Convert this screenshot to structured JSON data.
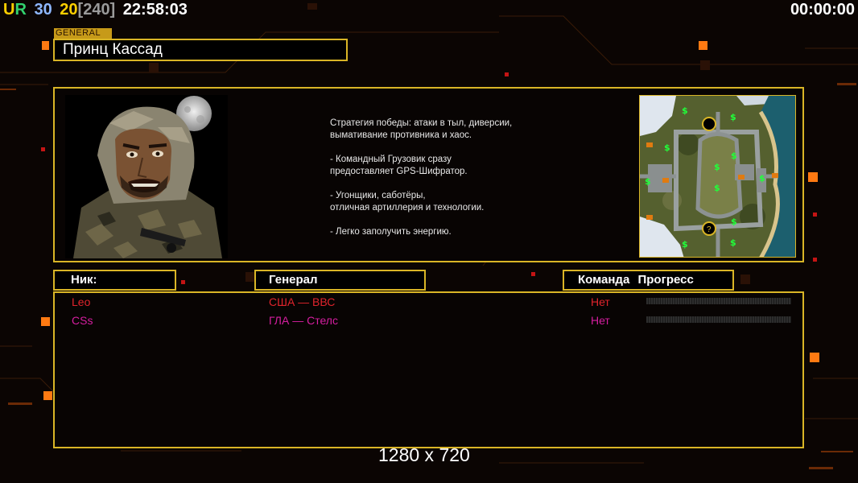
{
  "hud": {
    "ur": "UR",
    "n1": "30",
    "n2": "20",
    "bracket": "[240]",
    "time": "22:58:03",
    "timer": "00:00:00"
  },
  "general": {
    "tag": "GENERAL",
    "name": "Принц Кассад"
  },
  "description": [
    "Стратегия победы: атаки в тыл, диверсии,\n вымативание противника и хаос.",
    "- Командный Грузовик сразу\nпредоставляет GPS-Шифратор.",
    "- Угонщики, саботёры,\nотличная артиллерия и технологии.",
    "- Легко заполучить энергию."
  ],
  "table": {
    "headers": {
      "nick": "Ник:",
      "general": "Генерал",
      "team": "Команда",
      "progress": "Прогресс"
    },
    "rows": [
      {
        "nick": "Leo",
        "general": "США — ВВС",
        "team": "Нет",
        "color": "#e0242c",
        "progress": 0
      },
      {
        "nick": "CSs",
        "general": "ГЛА — Стелс",
        "team": "Нет",
        "color": "#d61ea0",
        "progress": 0
      }
    ]
  },
  "resolution": "1280 x 720",
  "colors": {
    "accent": "#d9b526",
    "ur_u": "#ffcf00",
    "ur_r": "#32d26e",
    "n1": "#8fb8ff",
    "n2": "#ffd000",
    "bracket": "#9a9a9a",
    "map_money": "#21ff3a"
  },
  "minimap_icons": [
    "money-icon",
    "building-icon",
    "spawn-icon"
  ]
}
